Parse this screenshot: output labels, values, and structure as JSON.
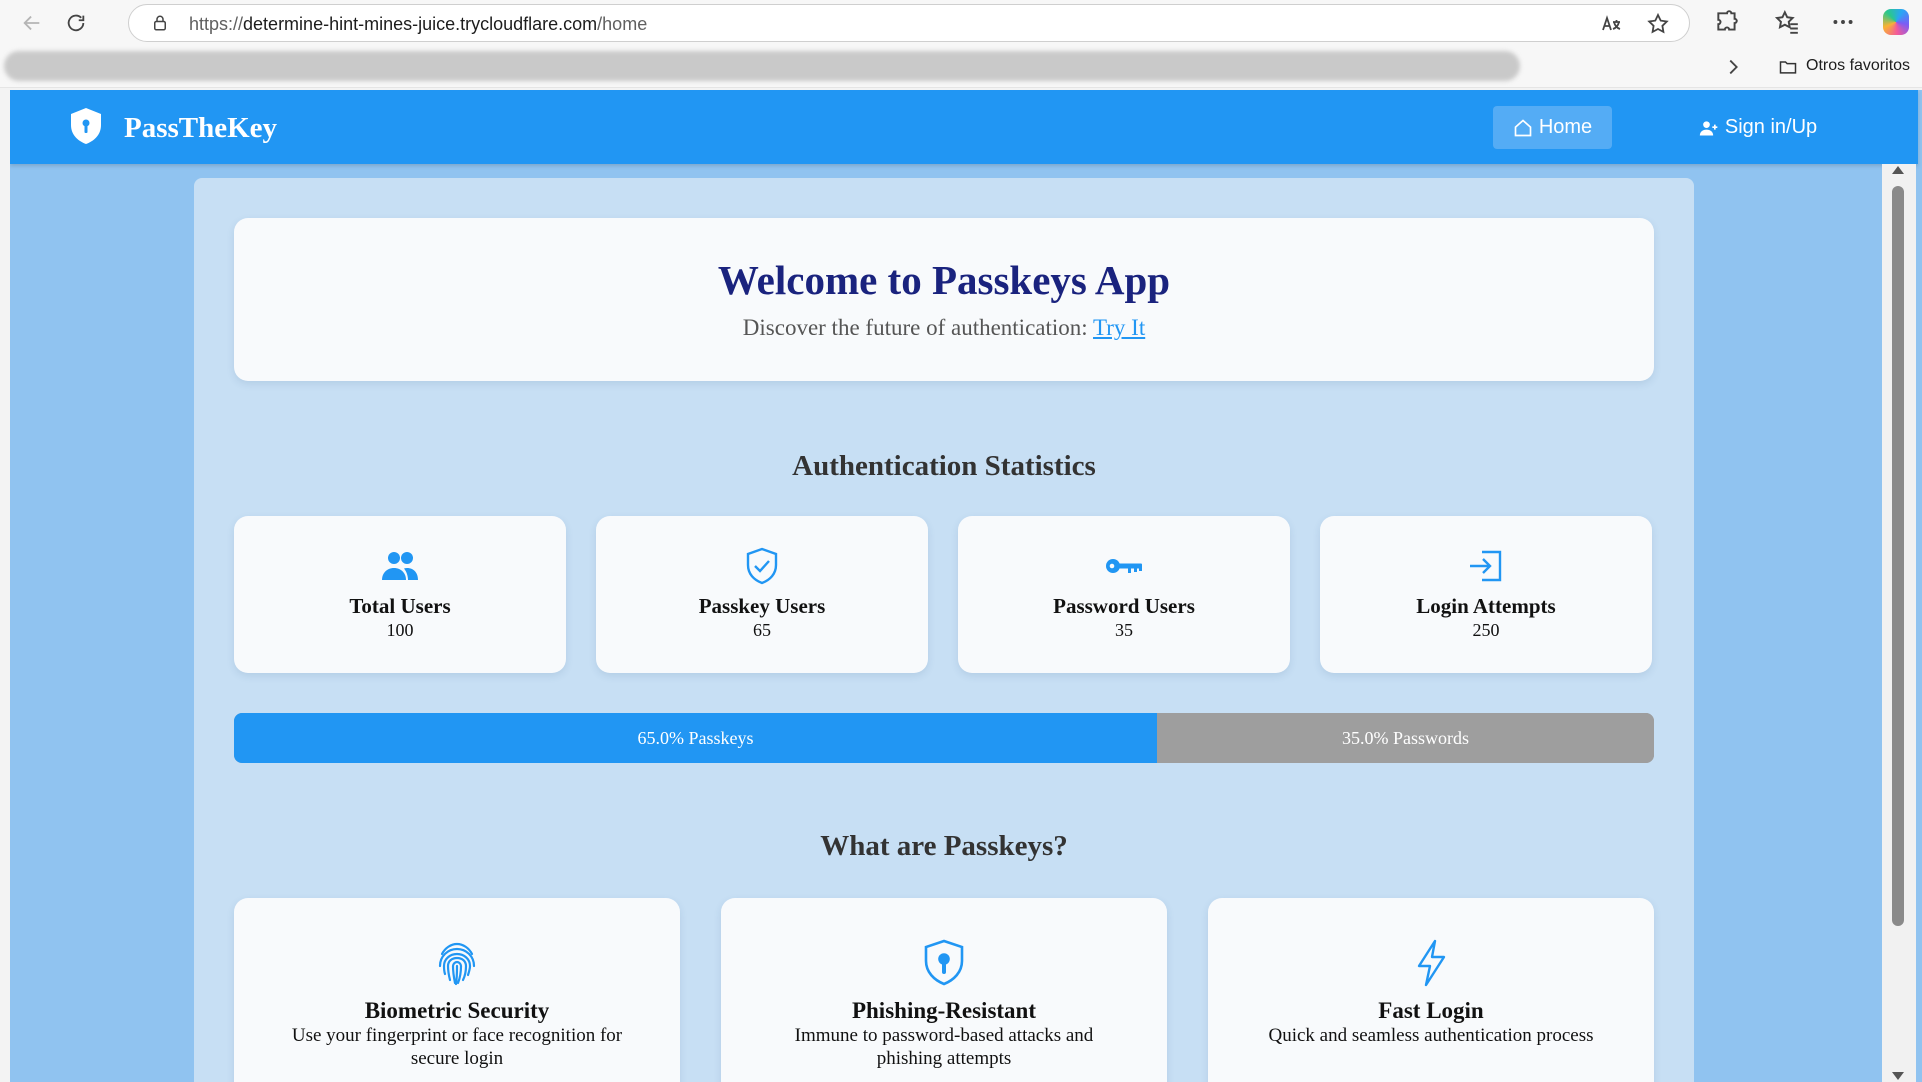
{
  "browser": {
    "url_scheme": "https://",
    "url_host": "determine-hint-mines-juice.trycloudflare.com",
    "url_path": "/home",
    "favorites_folder": "Otros favoritos"
  },
  "header": {
    "brand": "PassTheKey",
    "nav": {
      "home": "Home",
      "sign_in": "Sign in/Up"
    },
    "color": "#2196f3"
  },
  "welcome": {
    "title": "Welcome to Passkeys App",
    "subtitle": "Discover the future of authentication:",
    "link": "Try It"
  },
  "stats": {
    "title": "Authentication Statistics",
    "cards": [
      {
        "label": "Total Users",
        "value": "100",
        "icon": "users-icon"
      },
      {
        "label": "Passkey Users",
        "value": "65",
        "icon": "shield-check-icon"
      },
      {
        "label": "Password Users",
        "value": "35",
        "icon": "key-icon"
      },
      {
        "label": "Login Attempts",
        "value": "250",
        "icon": "login-icon"
      }
    ],
    "bar": {
      "passkeys_fraction": 0.65,
      "passkeys_label": "65.0% Passkeys",
      "passwords_label": "35.0% Passwords",
      "passkeys_color": "#2196f3",
      "passwords_color": "#9e9e9e"
    }
  },
  "features": {
    "title": "What are Passkeys?",
    "items": [
      {
        "title": "Biometric Security",
        "desc": "Use your fingerprint or face recognition for secure login",
        "icon": "fingerprint-icon"
      },
      {
        "title": "Phishing-Resistant",
        "desc": "Immune to password-based attacks and phishing attempts",
        "icon": "shield-lock-icon"
      },
      {
        "title": "Fast Login",
        "desc": "Quick and seamless authentication process",
        "icon": "lightning-icon"
      }
    ]
  }
}
